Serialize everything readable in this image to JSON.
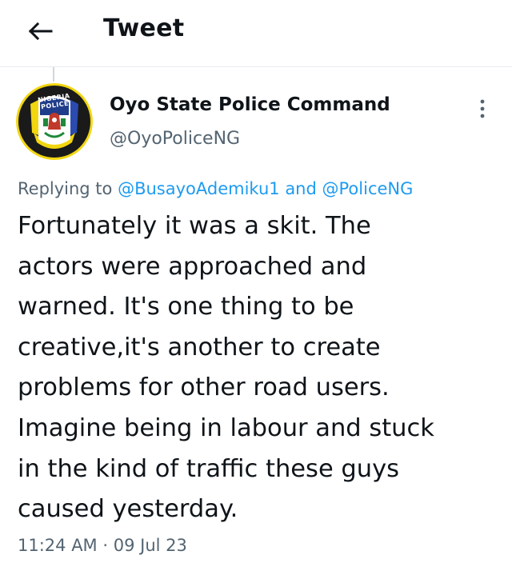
{
  "header": {
    "back_icon": "arrow-left-icon",
    "title": "Tweet"
  },
  "author": {
    "display_name": "Oyo State Police Command",
    "handle": "@OyoPoliceNG",
    "avatar": {
      "icon": "nigeria-police-badge",
      "badge_text_top": "NIGERIA",
      "badge_text_bottom": "POLICE",
      "colors": {
        "ring": "#1a1a1a",
        "yellow": "#f2d60f",
        "blue": "#2b4bb0",
        "green": "#1f8a3a"
      }
    },
    "more_icon": "more-vertical-icon"
  },
  "reply": {
    "prefix": "Replying to",
    "mention_1": "@BusayoAdemiku1",
    "conjunction": "and",
    "mention_2": "@PoliceNG"
  },
  "tweet": {
    "text": "Fortunately it was a skit. The\nactors were approached and\nwarned. It's one thing to be\ncreative,it's another to create\nproblems for other road users.\nImagine being in labour and stuck\nin the kind of traffic these guys\ncaused yesterday."
  },
  "meta": {
    "time": "11:24 AM",
    "separator": "·",
    "date": "09 Jul 23"
  },
  "colors": {
    "link": "#1d9bf0",
    "secondary_text": "#536471",
    "primary_text": "#0f1419",
    "divider": "#e6ecf0"
  }
}
